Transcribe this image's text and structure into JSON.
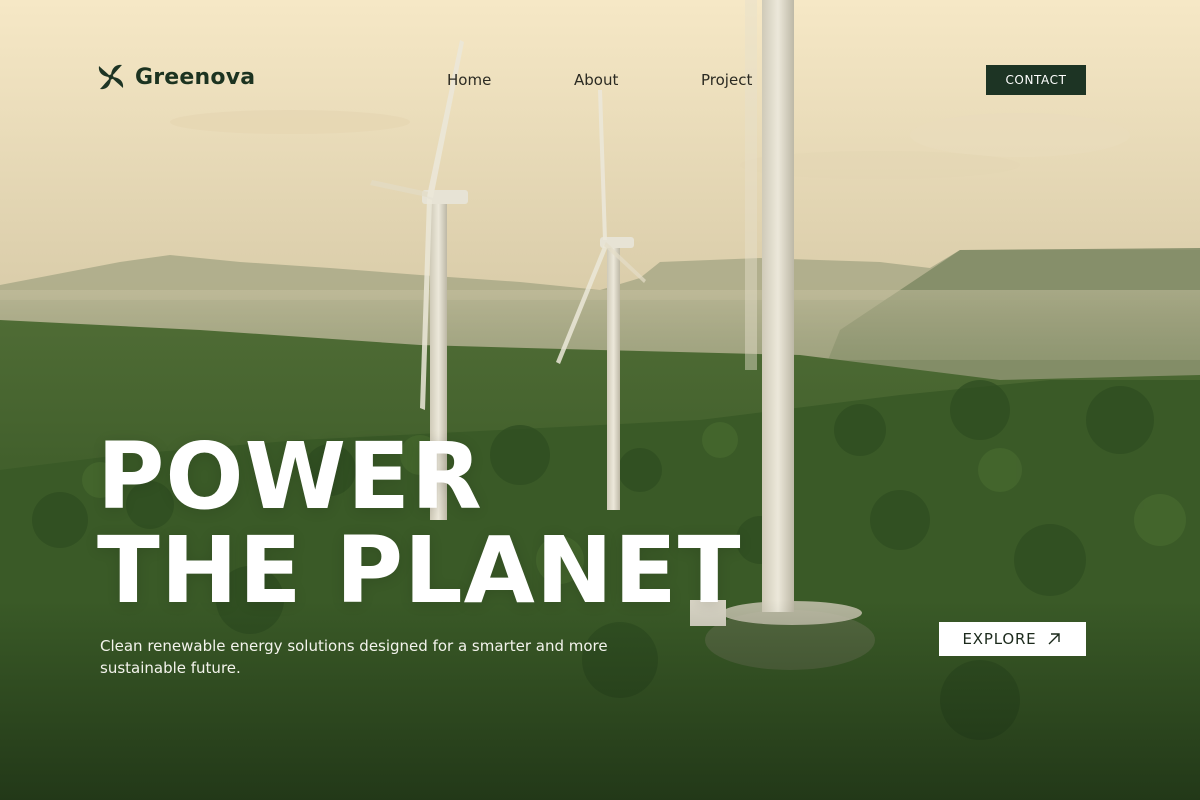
{
  "brand": {
    "name": "Greenova",
    "logo_icon": "pinwheel-logo-icon",
    "color": "#1d3424"
  },
  "nav": {
    "links": [
      {
        "label": "Home"
      },
      {
        "label": "About"
      },
      {
        "label": "Project"
      }
    ],
    "contact_label": "CONTACT"
  },
  "hero": {
    "title_line1": "POWER",
    "title_line2": "THE PLANET",
    "subtitle": "Clean renewable energy solutions designed for a smarter and more sustainable future.",
    "cta_label": "EXPLORE",
    "cta_icon": "arrow-up-right-icon"
  },
  "colors": {
    "accent_dark": "#1d3424",
    "hero_text": "#ffffff"
  }
}
